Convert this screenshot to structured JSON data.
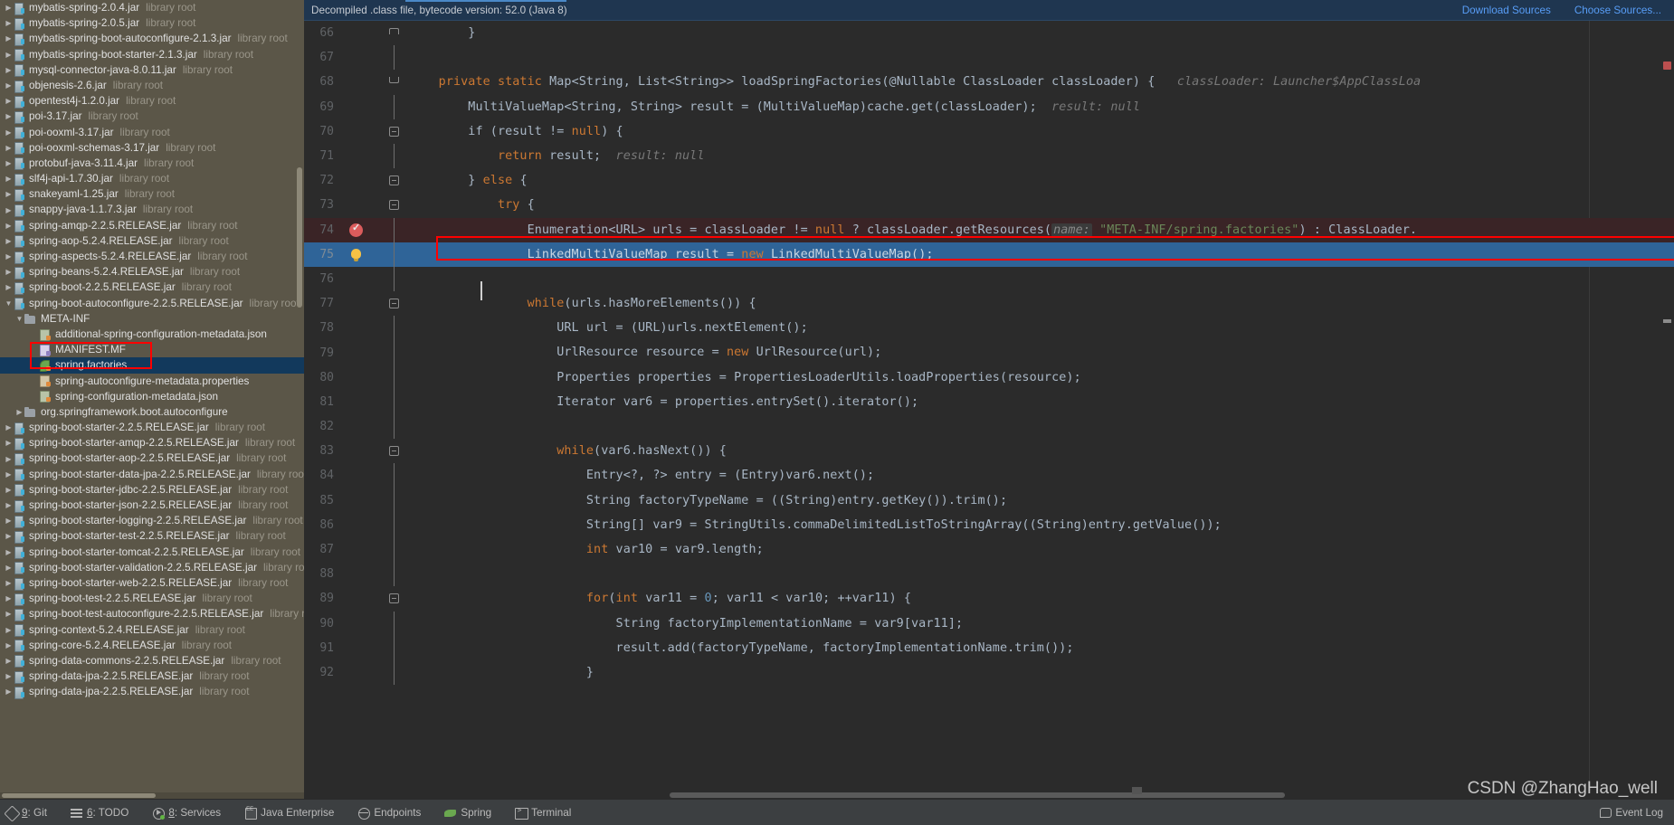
{
  "notification": {
    "message": "Decompiled .class file, bytecode version: 52.0 (Java 8)",
    "download_sources": "Download Sources",
    "choose_sources": "Choose Sources..."
  },
  "sidebar": {
    "items": [
      {
        "name": "mybatis-spring-2.0.4.jar",
        "meta": "library root",
        "icon": "jar-icon",
        "indent": 0,
        "arrow": "▶",
        "selected": false
      },
      {
        "name": "mybatis-spring-2.0.5.jar",
        "meta": "library root",
        "icon": "jar-icon",
        "indent": 0,
        "arrow": "▶",
        "selected": false
      },
      {
        "name": "mybatis-spring-boot-autoconfigure-2.1.3.jar",
        "meta": "library root",
        "icon": "jar-icon",
        "indent": 0,
        "arrow": "▶",
        "selected": false
      },
      {
        "name": "mybatis-spring-boot-starter-2.1.3.jar",
        "meta": "library root",
        "icon": "jar-icon",
        "indent": 0,
        "arrow": "▶",
        "selected": false
      },
      {
        "name": "mysql-connector-java-8.0.11.jar",
        "meta": "library root",
        "icon": "jar-icon",
        "indent": 0,
        "arrow": "▶",
        "selected": false
      },
      {
        "name": "objenesis-2.6.jar",
        "meta": "library root",
        "icon": "jar-icon",
        "indent": 0,
        "arrow": "▶",
        "selected": false
      },
      {
        "name": "opentest4j-1.2.0.jar",
        "meta": "library root",
        "icon": "jar-icon",
        "indent": 0,
        "arrow": "▶",
        "selected": false
      },
      {
        "name": "poi-3.17.jar",
        "meta": "library root",
        "icon": "jar-icon",
        "indent": 0,
        "arrow": "▶",
        "selected": false
      },
      {
        "name": "poi-ooxml-3.17.jar",
        "meta": "library root",
        "icon": "jar-icon",
        "indent": 0,
        "arrow": "▶",
        "selected": false
      },
      {
        "name": "poi-ooxml-schemas-3.17.jar",
        "meta": "library root",
        "icon": "jar-icon",
        "indent": 0,
        "arrow": "▶",
        "selected": false
      },
      {
        "name": "protobuf-java-3.11.4.jar",
        "meta": "library root",
        "icon": "jar-icon",
        "indent": 0,
        "arrow": "▶",
        "selected": false
      },
      {
        "name": "slf4j-api-1.7.30.jar",
        "meta": "library root",
        "icon": "jar-icon",
        "indent": 0,
        "arrow": "▶",
        "selected": false
      },
      {
        "name": "snakeyaml-1.25.jar",
        "meta": "library root",
        "icon": "jar-icon",
        "indent": 0,
        "arrow": "▶",
        "selected": false
      },
      {
        "name": "snappy-java-1.1.7.3.jar",
        "meta": "library root",
        "icon": "jar-icon",
        "indent": 0,
        "arrow": "▶",
        "selected": false
      },
      {
        "name": "spring-amqp-2.2.5.RELEASE.jar",
        "meta": "library root",
        "icon": "jar-icon",
        "indent": 0,
        "arrow": "▶",
        "selected": false
      },
      {
        "name": "spring-aop-5.2.4.RELEASE.jar",
        "meta": "library root",
        "icon": "jar-icon",
        "indent": 0,
        "arrow": "▶",
        "selected": false
      },
      {
        "name": "spring-aspects-5.2.4.RELEASE.jar",
        "meta": "library root",
        "icon": "jar-icon",
        "indent": 0,
        "arrow": "▶",
        "selected": false
      },
      {
        "name": "spring-beans-5.2.4.RELEASE.jar",
        "meta": "library root",
        "icon": "jar-icon",
        "indent": 0,
        "arrow": "▶",
        "selected": false
      },
      {
        "name": "spring-boot-2.2.5.RELEASE.jar",
        "meta": "library root",
        "icon": "jar-icon",
        "indent": 0,
        "arrow": "▶",
        "selected": false
      },
      {
        "name": "spring-boot-autoconfigure-2.2.5.RELEASE.jar",
        "meta": "library root",
        "icon": "jar-icon",
        "indent": 0,
        "arrow": "▼",
        "selected": false
      },
      {
        "name": "META-INF",
        "meta": "",
        "icon": "folder-icon",
        "indent": 1,
        "arrow": "▼",
        "selected": false
      },
      {
        "name": "additional-spring-configuration-metadata.json",
        "meta": "",
        "icon": "json-file-icon",
        "indent": 2,
        "arrow": "",
        "selected": false
      },
      {
        "name": "MANIFEST.MF",
        "meta": "",
        "icon": "manifest-file-icon",
        "indent": 2,
        "arrow": "",
        "selected": false
      },
      {
        "name": "spring.factories",
        "meta": "",
        "icon": "leaf-file-icon",
        "indent": 2,
        "arrow": "",
        "selected": true
      },
      {
        "name": "spring-autoconfigure-metadata.properties",
        "meta": "",
        "icon": "properties-file-icon",
        "indent": 2,
        "arrow": "",
        "selected": false
      },
      {
        "name": "spring-configuration-metadata.json",
        "meta": "",
        "icon": "json-file-icon",
        "indent": 2,
        "arrow": "",
        "selected": false
      },
      {
        "name": "org.springframework.boot.autoconfigure",
        "meta": "",
        "icon": "folder-icon",
        "indent": 1,
        "arrow": "▶",
        "selected": false
      },
      {
        "name": "spring-boot-starter-2.2.5.RELEASE.jar",
        "meta": "library root",
        "icon": "jar-icon",
        "indent": 0,
        "arrow": "▶",
        "selected": false
      },
      {
        "name": "spring-boot-starter-amqp-2.2.5.RELEASE.jar",
        "meta": "library root",
        "icon": "jar-icon",
        "indent": 0,
        "arrow": "▶",
        "selected": false
      },
      {
        "name": "spring-boot-starter-aop-2.2.5.RELEASE.jar",
        "meta": "library root",
        "icon": "jar-icon",
        "indent": 0,
        "arrow": "▶",
        "selected": false
      },
      {
        "name": "spring-boot-starter-data-jpa-2.2.5.RELEASE.jar",
        "meta": "library root",
        "icon": "jar-icon",
        "indent": 0,
        "arrow": "▶",
        "selected": false
      },
      {
        "name": "spring-boot-starter-jdbc-2.2.5.RELEASE.jar",
        "meta": "library root",
        "icon": "jar-icon",
        "indent": 0,
        "arrow": "▶",
        "selected": false
      },
      {
        "name": "spring-boot-starter-json-2.2.5.RELEASE.jar",
        "meta": "library root",
        "icon": "jar-icon",
        "indent": 0,
        "arrow": "▶",
        "selected": false
      },
      {
        "name": "spring-boot-starter-logging-2.2.5.RELEASE.jar",
        "meta": "library root",
        "icon": "jar-icon",
        "indent": 0,
        "arrow": "▶",
        "selected": false
      },
      {
        "name": "spring-boot-starter-test-2.2.5.RELEASE.jar",
        "meta": "library root",
        "icon": "jar-icon",
        "indent": 0,
        "arrow": "▶",
        "selected": false
      },
      {
        "name": "spring-boot-starter-tomcat-2.2.5.RELEASE.jar",
        "meta": "library root",
        "icon": "jar-icon",
        "indent": 0,
        "arrow": "▶",
        "selected": false
      },
      {
        "name": "spring-boot-starter-validation-2.2.5.RELEASE.jar",
        "meta": "library root",
        "icon": "jar-icon",
        "indent": 0,
        "arrow": "▶",
        "selected": false
      },
      {
        "name": "spring-boot-starter-web-2.2.5.RELEASE.jar",
        "meta": "library root",
        "icon": "jar-icon",
        "indent": 0,
        "arrow": "▶",
        "selected": false
      },
      {
        "name": "spring-boot-test-2.2.5.RELEASE.jar",
        "meta": "library root",
        "icon": "jar-icon",
        "indent": 0,
        "arrow": "▶",
        "selected": false
      },
      {
        "name": "spring-boot-test-autoconfigure-2.2.5.RELEASE.jar",
        "meta": "library root",
        "icon": "jar-icon",
        "indent": 0,
        "arrow": "▶",
        "selected": false
      },
      {
        "name": "spring-context-5.2.4.RELEASE.jar",
        "meta": "library root",
        "icon": "jar-icon",
        "indent": 0,
        "arrow": "▶",
        "selected": false
      },
      {
        "name": "spring-core-5.2.4.RELEASE.jar",
        "meta": "library root",
        "icon": "jar-icon",
        "indent": 0,
        "arrow": "▶",
        "selected": false
      },
      {
        "name": "spring-data-commons-2.2.5.RELEASE.jar",
        "meta": "library root",
        "icon": "jar-icon",
        "indent": 0,
        "arrow": "▶",
        "selected": false
      },
      {
        "name": "spring-data-jpa-2.2.5.RELEASE.jar",
        "meta": "library root",
        "icon": "jar-icon",
        "indent": 0,
        "arrow": "▶",
        "selected": false
      },
      {
        "name": "spring-data-jpa-2.2.5.RELEASE.jar",
        "meta": "library root",
        "icon": "jar-icon",
        "indent": 0,
        "arrow": "▶",
        "selected": false
      }
    ]
  },
  "code": {
    "lines": [
      {
        "num": "66",
        "indent": 0,
        "fold": "up",
        "state": "normal"
      },
      {
        "num": "67",
        "indent": 0,
        "fold": "",
        "state": "normal"
      },
      {
        "num": "68",
        "indent": 0,
        "fold": "down",
        "state": "normal"
      },
      {
        "num": "69",
        "indent": 0,
        "fold": "",
        "state": "normal"
      },
      {
        "num": "70",
        "indent": 0,
        "fold": "box",
        "state": "normal"
      },
      {
        "num": "71",
        "indent": 0,
        "fold": "",
        "state": "normal"
      },
      {
        "num": "72",
        "indent": 0,
        "fold": "box",
        "state": "normal"
      },
      {
        "num": "73",
        "indent": 0,
        "fold": "box",
        "state": "normal"
      },
      {
        "num": "74",
        "indent": 0,
        "fold": "",
        "state": "breakpoint"
      },
      {
        "num": "75",
        "indent": 0,
        "fold": "",
        "state": "selected"
      },
      {
        "num": "76",
        "indent": 0,
        "fold": "",
        "state": "caret"
      },
      {
        "num": "77",
        "indent": 0,
        "fold": "box",
        "state": "normal"
      },
      {
        "num": "78",
        "indent": 0,
        "fold": "",
        "state": "normal"
      },
      {
        "num": "79",
        "indent": 0,
        "fold": "",
        "state": "normal"
      },
      {
        "num": "80",
        "indent": 0,
        "fold": "",
        "state": "normal"
      },
      {
        "num": "81",
        "indent": 0,
        "fold": "",
        "state": "normal"
      },
      {
        "num": "82",
        "indent": 0,
        "fold": "",
        "state": "normal"
      },
      {
        "num": "83",
        "indent": 0,
        "fold": "box",
        "state": "normal"
      },
      {
        "num": "84",
        "indent": 0,
        "fold": "",
        "state": "normal"
      },
      {
        "num": "85",
        "indent": 0,
        "fold": "",
        "state": "normal"
      },
      {
        "num": "86",
        "indent": 0,
        "fold": "",
        "state": "normal"
      },
      {
        "num": "87",
        "indent": 0,
        "fold": "",
        "state": "normal"
      },
      {
        "num": "88",
        "indent": 0,
        "fold": "",
        "state": "normal"
      },
      {
        "num": "89",
        "indent": 0,
        "fold": "box",
        "state": "normal"
      },
      {
        "num": "90",
        "indent": 0,
        "fold": "",
        "state": "normal"
      },
      {
        "num": "91",
        "indent": 0,
        "fold": "",
        "state": "normal"
      },
      {
        "num": "92",
        "indent": 0,
        "fold": "",
        "state": "normal"
      }
    ],
    "text": {
      "l66": "        }",
      "l67": "",
      "l68_a": "    private static ",
      "l68_b": "Map<String, List<String>> loadSpringFactories(@Nullable ClassLoader classLoader) {",
      "l68_hint": "classLoader: Launcher$AppClassLoa",
      "l69": "        MultiValueMap<String, String> result = (MultiValueMap)cache.get(classLoader);",
      "l69_hint": "result: null",
      "l70_a": "        if (result != ",
      "l70_b": "null",
      "l70_c": ") {",
      "l71_a": "            return",
      "l71_b": " result;",
      "l71_hint": "result: null",
      "l72_a": "        } ",
      "l72_b": "else",
      "l72_c": " {",
      "l73_a": "            try",
      "l73_b": " {",
      "l74_a": "                Enumeration<URL> urls = classLoader != ",
      "l74_b": "null",
      "l74_c": " ? classLoader.getResources(",
      "l74_hint": "name:",
      "l74_str": "\"META-INF/spring.factories\"",
      "l74_d": ") : ClassLoader.",
      "l75_a": "                LinkedMultiValueMap result = ",
      "l75_b": "new",
      "l75_c": " LinkedMultiValueMap();",
      "l76": "",
      "l77_a": "                while",
      "l77_b": "(urls.hasMoreElements()) {",
      "l78": "                    URL url = (URL)urls.nextElement();",
      "l79_a": "                    UrlResource resource = ",
      "l79_b": "new",
      "l79_c": " UrlResource(url);",
      "l80": "                    Properties properties = PropertiesLoaderUtils.loadProperties(resource);",
      "l81": "                    Iterator var6 = properties.entrySet().iterator();",
      "l82": "",
      "l83_a": "                    while",
      "l83_b": "(var6.hasNext()) {",
      "l84": "                        Entry<?, ?> entry = (Entry)var6.next();",
      "l85": "                        String factoryTypeName = ((String)entry.getKey()).trim();",
      "l86": "                        String[] var9 = StringUtils.commaDelimitedListToStringArray((String)entry.getValue());",
      "l87_a": "                        int",
      "l87_b": " var10 = var9.length;",
      "l88": "",
      "l89_a": "                        for",
      "l89_b": "(",
      "l89_c": "int",
      "l89_d": " var11 = ",
      "l89_e": "0",
      "l89_f": "; var11 < var10; ++var11) {",
      "l90": "                            String factoryImplementationName = var9[var11];",
      "l91": "                            result.add(factoryTypeName, factoryImplementationName.trim());",
      "l92": "                        }"
    }
  },
  "statusbar": {
    "items": [
      {
        "label": "9: Git",
        "mnemonic": "9",
        "icon": "git-icon"
      },
      {
        "label": "6: TODO",
        "mnemonic": "6",
        "icon": "todo-icon"
      },
      {
        "label": "8: Services",
        "mnemonic": "8",
        "icon": "services-icon"
      },
      {
        "label": "Java Enterprise",
        "mnemonic": "",
        "icon": "java-enterprise-icon"
      },
      {
        "label": "Endpoints",
        "mnemonic": "",
        "icon": "endpoints-icon"
      },
      {
        "label": "Spring",
        "mnemonic": "",
        "icon": "spring-leaf-icon"
      },
      {
        "label": "Terminal",
        "mnemonic": "",
        "icon": "terminal-icon"
      }
    ],
    "event_log": "Event Log"
  },
  "watermark": "CSDN @ZhangHao_well",
  "colors": {
    "sidebar_bg": "#5b5648",
    "editor_bg": "#2b2b2b",
    "selection_blue": "#2f6498",
    "breakpoint_row": "#3a2426",
    "annotation_red": "#ff0000",
    "link_blue": "#589df6",
    "keyword_orange": "#cc7832",
    "string_green": "#6a8759",
    "number_blue": "#6897bb"
  }
}
